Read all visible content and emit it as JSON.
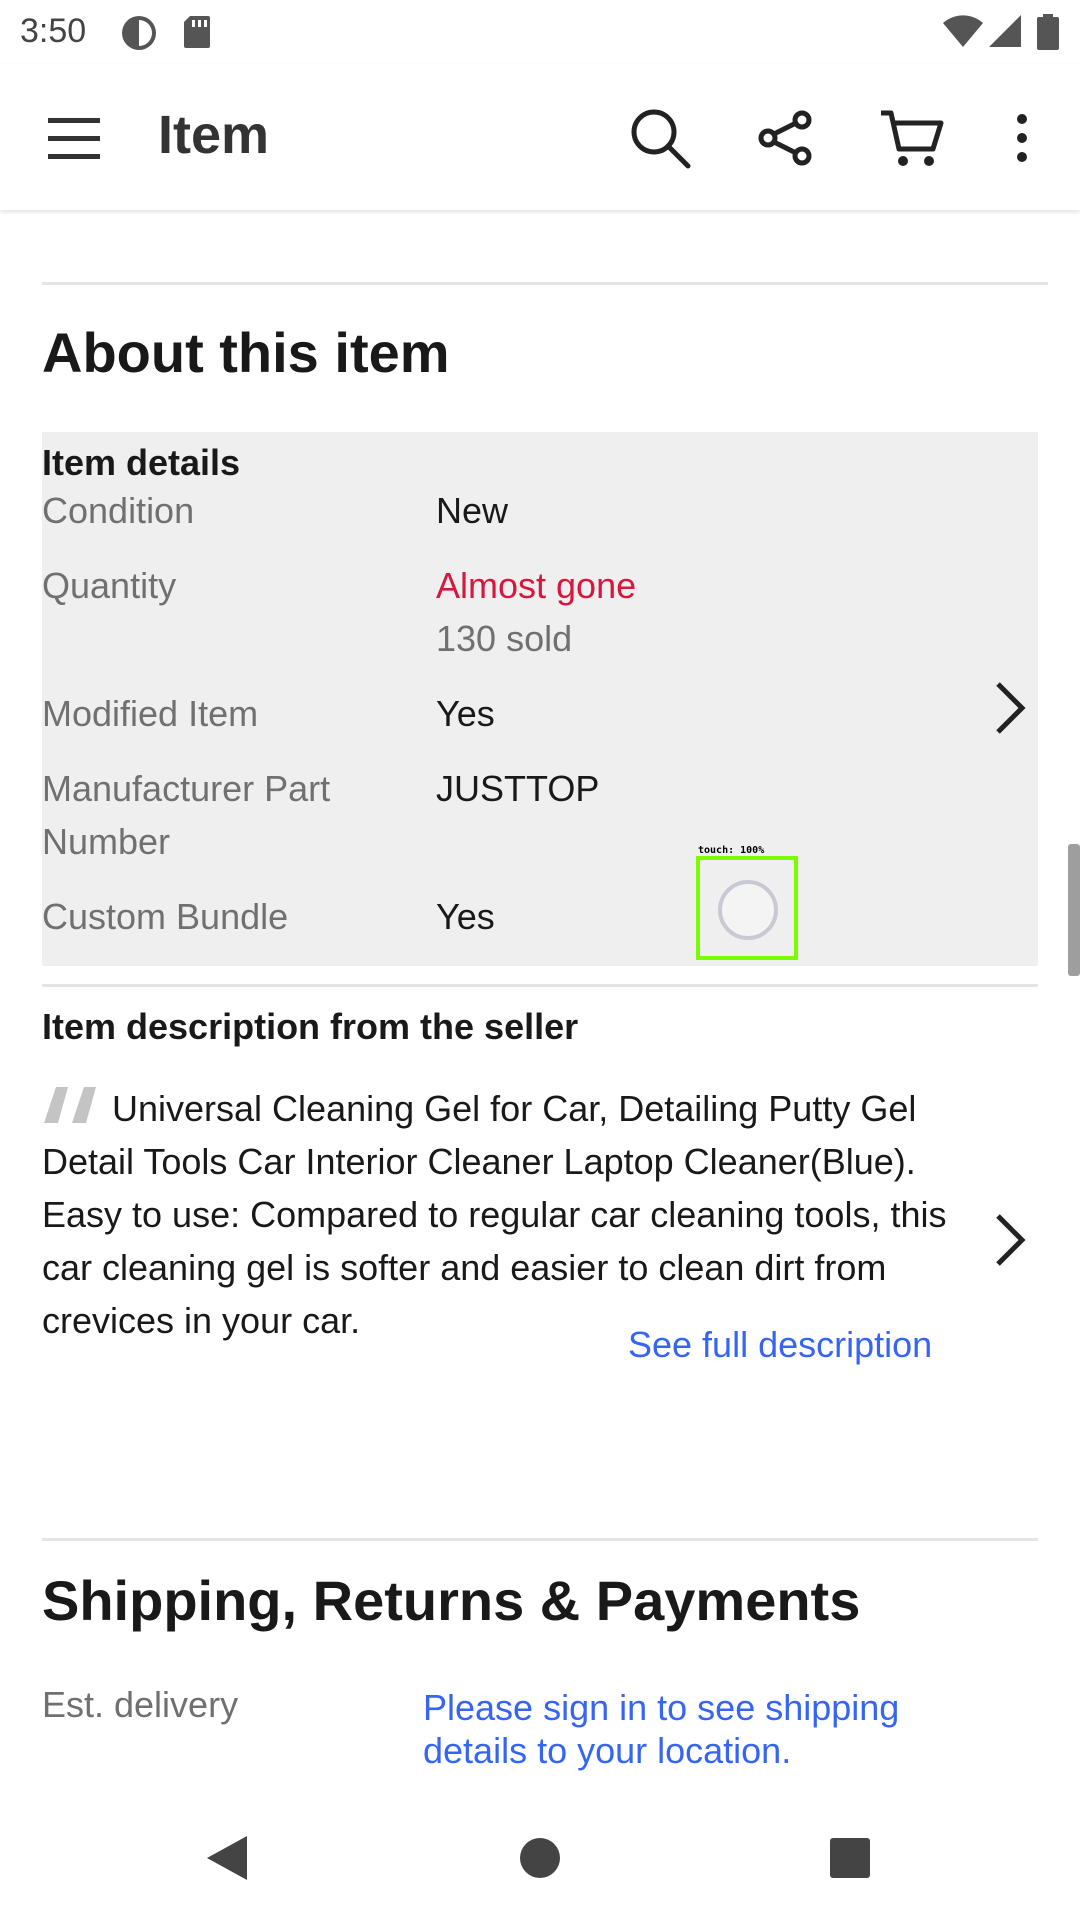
{
  "status_bar": {
    "time": "3:50",
    "icons": [
      "data-saver-icon",
      "sd-card-icon",
      "wifi-icon",
      "signal-icon",
      "battery-icon"
    ]
  },
  "app_bar": {
    "title": "Item",
    "actions": [
      "menu-icon",
      "search-icon",
      "share-icon",
      "cart-icon",
      "more-vert-icon"
    ]
  },
  "about": {
    "title": "About this item",
    "item_details": {
      "heading": "Item details",
      "rows": [
        {
          "label": "Condition",
          "value": "New"
        },
        {
          "label": "Quantity",
          "value": "Almost gone",
          "sub_value": "130 sold"
        },
        {
          "label": "Modified Item",
          "value": "Yes"
        },
        {
          "label": "Manufacturer Part Number",
          "value": "JUSTTOP"
        },
        {
          "label": "Custom Bundle",
          "value": "Yes"
        }
      ]
    },
    "description": {
      "heading": "Item description from the seller",
      "text": "Universal Cleaning Gel for Car, Detailing Putty Gel Detail Tools Car Interior Cleaner Laptop Cleaner(Blue). Easy to use: Compared to regular car cleaning tools, this car cleaning gel is softer and easier to clean dirt from crevices in your car.",
      "link": "See full description"
    }
  },
  "shipping": {
    "title": "Shipping, Returns & Payments",
    "est_delivery_label": "Est. delivery",
    "est_delivery_value": "Please sign in to see shipping details to your location."
  },
  "touch_overlay": {
    "label": "touch: 100%"
  },
  "colors": {
    "alert": "#d6173e",
    "link": "#3665f3",
    "details_bg": "#efefef",
    "touch_box": "#7cfc00"
  }
}
